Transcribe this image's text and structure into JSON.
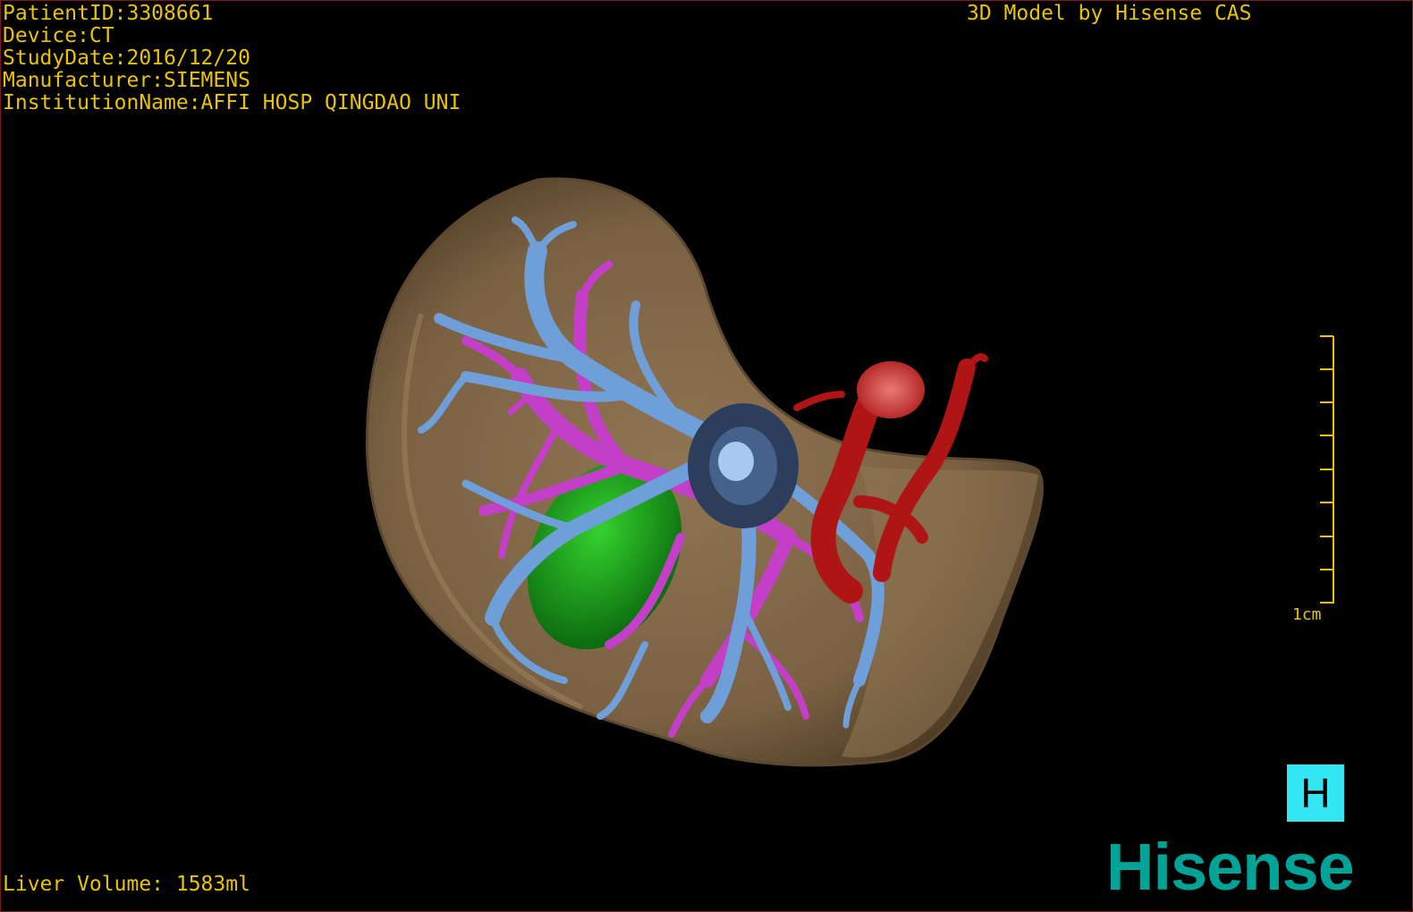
{
  "patient_info": {
    "patient_id": "PatientID:3308661",
    "device": "Device:CT",
    "study_date": "StudyDate:2016/12/20",
    "manufacturer": "Manufacturer:SIEMENS",
    "institution": "InstitutionName:AFFI HOSP QINGDAO UNI"
  },
  "header": {
    "model_credit": "3D Model by Hisense CAS"
  },
  "footer": {
    "liver_volume": "Liver Volume: 1583ml"
  },
  "scale_bar": {
    "label": "1cm",
    "tick_count": 9
  },
  "orientation": {
    "label": "H"
  },
  "logo": {
    "text": "Hisense",
    "color": "#00a396"
  },
  "colors": {
    "text": "#e8c400",
    "liver": "#8a6d4a",
    "hepatic_vein": "#6f9fd8",
    "portal_vein": "#c43fc7",
    "gallbladder": "#17a21a",
    "artery": "#b01515",
    "orientation_bg": "#33e6f2"
  }
}
